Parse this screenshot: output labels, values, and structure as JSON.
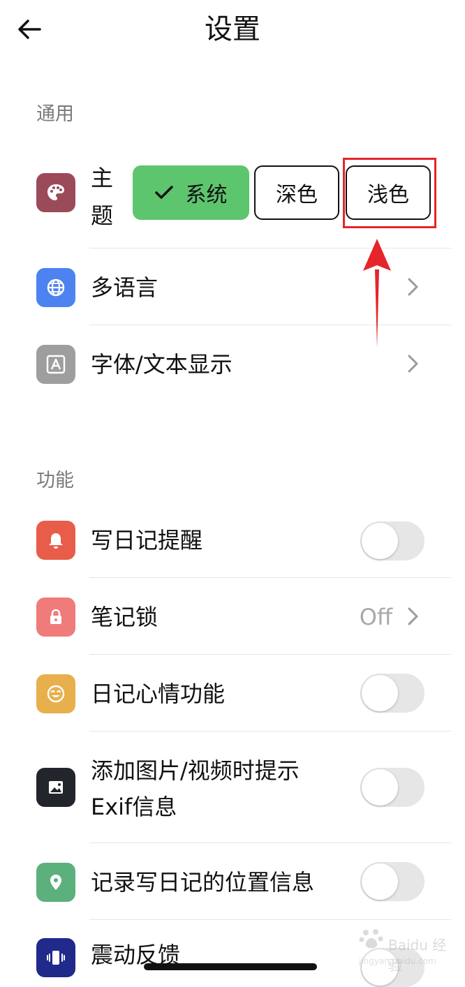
{
  "header": {
    "title": "设置"
  },
  "sections": {
    "general": "通用",
    "features": "功能"
  },
  "theme": {
    "label_line1": "主",
    "label_line2": "题",
    "options": {
      "system": "系统",
      "dark": "深色",
      "light": "浅色"
    },
    "selected": "系统"
  },
  "general_items": {
    "language": "多语言",
    "font": "字体/文本显示"
  },
  "feature_items": {
    "reminder": "写日记提醒",
    "lock": "笔记锁",
    "lock_value": "Off",
    "mood": "日记心情功能",
    "exif_line1": "添加图片/视频时提示",
    "exif_line2": "Exif信息",
    "location": "记录写日记的位置信息",
    "vibration": "震动反馈"
  },
  "watermark": {
    "brand": "Baidu 经验",
    "url": "jingyan.baidu.com"
  },
  "colors": {
    "theme_icon": "#9b4a5a",
    "language_icon": "#4c83f0",
    "font_icon": "#9e9e9e",
    "reminder_icon": "#e85d4a",
    "lock_icon": "#ef7b7b",
    "mood_icon": "#e7b04d",
    "exif_icon": "#22252b",
    "location_icon": "#5bb07c",
    "vibration_icon": "#1f2a8a",
    "selected_green": "#5ec56f",
    "annotation_red": "#e5252b"
  },
  "icons": {
    "back": "arrow-left-icon",
    "theme": "palette-icon",
    "language": "globe-icon",
    "font": "font-a-icon",
    "reminder": "bell-icon",
    "lock": "lock-icon",
    "mood": "smiley-icon",
    "exif": "image-icon",
    "location": "location-pin-icon",
    "vibration": "vibrate-icon",
    "chevron": "chevron-right-icon"
  }
}
